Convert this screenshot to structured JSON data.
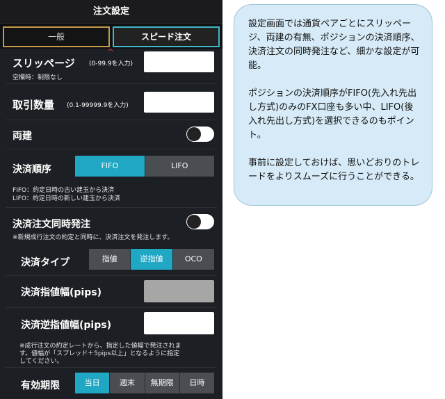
{
  "screen": {
    "title": "注文設定",
    "tabs": [
      {
        "label": "一般",
        "active": false
      },
      {
        "label": "スピード注文",
        "active": true
      }
    ],
    "slippage": {
      "label": "スリッページ",
      "range": "(0-99.9を入力)",
      "note": "空欄時：制限なし",
      "value": ""
    },
    "quantity": {
      "label": "取引数量",
      "range": "(0.1-99999.9を入力)",
      "value": ""
    },
    "hedging": {
      "label": "両建",
      "on": false
    },
    "settlement_order": {
      "label": "決済順序",
      "options": [
        "FIFO",
        "LIFO"
      ],
      "selected": "FIFO",
      "note_line1": "FIFO：約定日時の古い建玉から決済",
      "note_line2": "LIFO：約定日時の新しい建玉から決済"
    },
    "simultaneous": {
      "label": "決済注文同時発注",
      "on": false,
      "note": "※新規成行注文の約定と同時に、決済注文を発注します。"
    },
    "settlement_type": {
      "label": "決済タイプ",
      "options": [
        "指値",
        "逆指値",
        "OCO"
      ],
      "selected": "逆指値"
    },
    "limit_width": {
      "label": "決済指値幅(pips)",
      "value": ""
    },
    "stop_width": {
      "label": "決済逆指値幅(pips)",
      "value": ""
    },
    "width_note_line1": "※成行注文の約定レートから、指定した値幅で発注されま",
    "width_note_line2": "す。値幅が「スプレッド＋5pips以上」となるように指定",
    "width_note_line3": "してください。",
    "expiry": {
      "label": "有効期限",
      "options": [
        "当日",
        "週末",
        "無期限",
        "日時"
      ],
      "selected": "当日"
    }
  },
  "callout": {
    "para1": "設定画面では通貨ペアごとにスリッページ、両建の有無、ポジションの決済順序、決済注文の同時発注など、細かな設定が可能。",
    "para2": "ポジションの決済順序がFIFO(先入れ先出し方式)のみのFX口座も多い中、LIFO(後入れ先出し方式)を選択できるのもポイント。",
    "para3": "事前に設定しておけば、思いどおりのトレードをよりスムーズに行うことができる。"
  },
  "colors": {
    "accent": "#1fa7c3",
    "panel": "#1c1f24",
    "segment_off": "#4a4d52",
    "callout_bg": "#d6ebf7"
  }
}
